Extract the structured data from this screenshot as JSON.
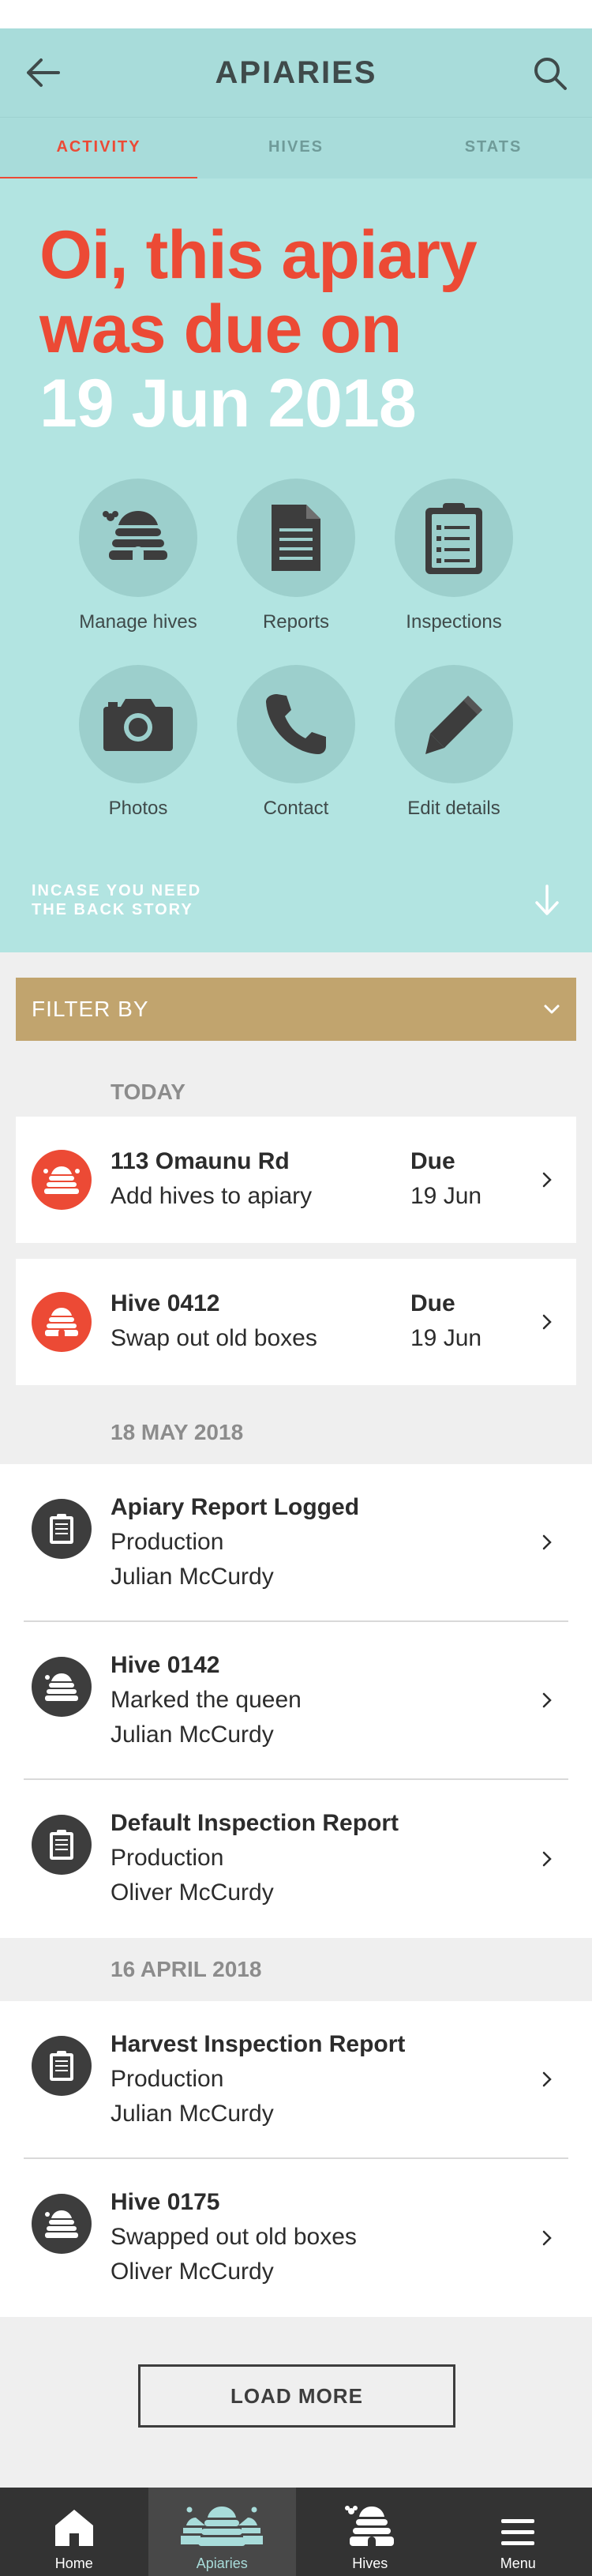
{
  "appbar": {
    "title": "APIARIES",
    "back_icon": "arrow-left-icon",
    "search_icon": "search-icon"
  },
  "tabs": [
    {
      "label": "ACTIVITY",
      "active": true
    },
    {
      "label": "HIVES",
      "active": false
    },
    {
      "label": "STATS",
      "active": false
    }
  ],
  "hero": {
    "line1": "Oi, this apiary",
    "line2": "was due on",
    "line3": "19 Jun 2018",
    "due_color": "#ec4a35",
    "date_color": "#ffffff"
  },
  "actions": [
    {
      "label": "Manage hives",
      "icon": "beehive-icon"
    },
    {
      "label": "Reports",
      "icon": "document-icon"
    },
    {
      "label": "Inspections",
      "icon": "clipboard-icon"
    },
    {
      "label": "Photos",
      "icon": "camera-icon"
    },
    {
      "label": "Contact",
      "icon": "phone-icon"
    },
    {
      "label": "Edit details",
      "icon": "pencil-icon"
    }
  ],
  "backstory": {
    "line1": "INCASE YOU NEED",
    "line2": "THE BACK STORY",
    "icon": "arrow-down-icon"
  },
  "filter": {
    "label": "FILTER BY",
    "icon": "chevron-down-icon"
  },
  "today": {
    "heading": "TODAY",
    "cards": [
      {
        "title": "113 Omaunu Rd",
        "subtitle": "Add hives to apiary",
        "due_label": "Due",
        "due_date": "19 Jun"
      },
      {
        "title": "Hive 0412",
        "subtitle": "Swap out old boxes",
        "due_label": "Due",
        "due_date": "19 Jun"
      }
    ]
  },
  "group1": {
    "heading": "18 MAY 2018",
    "items": [
      {
        "title": "Apiary Report Logged",
        "line2": "Production",
        "line3": "Julian McCurdy",
        "icon": "clipboard-icon"
      },
      {
        "title": "Hive 0142",
        "line2": "Marked the queen",
        "line3": "Julian McCurdy",
        "icon": "beehive-icon"
      },
      {
        "title": "Default Inspection Report",
        "line2": "Production",
        "line3": "Oliver McCurdy",
        "icon": "clipboard-icon"
      }
    ]
  },
  "group2": {
    "heading": "16 APRIL 2018",
    "items": [
      {
        "title": "Harvest Inspection Report",
        "line2": "Production",
        "line3": "Julian McCurdy",
        "icon": "clipboard-icon"
      },
      {
        "title": "Hive 0175",
        "line2": "Swapped out old boxes",
        "line3": "Oliver McCurdy",
        "icon": "beehive-icon"
      }
    ]
  },
  "load_more": "LOAD MORE",
  "bottom_nav": [
    {
      "label": "Home",
      "icon": "home-icon",
      "active": false
    },
    {
      "label": "Apiaries",
      "icon": "apiaries-icon",
      "active": true
    },
    {
      "label": "Hives",
      "icon": "beehive-icon",
      "active": false
    },
    {
      "label": "Menu",
      "icon": "menu-icon",
      "active": false
    }
  ],
  "colors": {
    "accent": "#ec4a35",
    "teal": "#b2e4e1",
    "filter": "#c1a46e",
    "dark": "#3d3d3d"
  }
}
